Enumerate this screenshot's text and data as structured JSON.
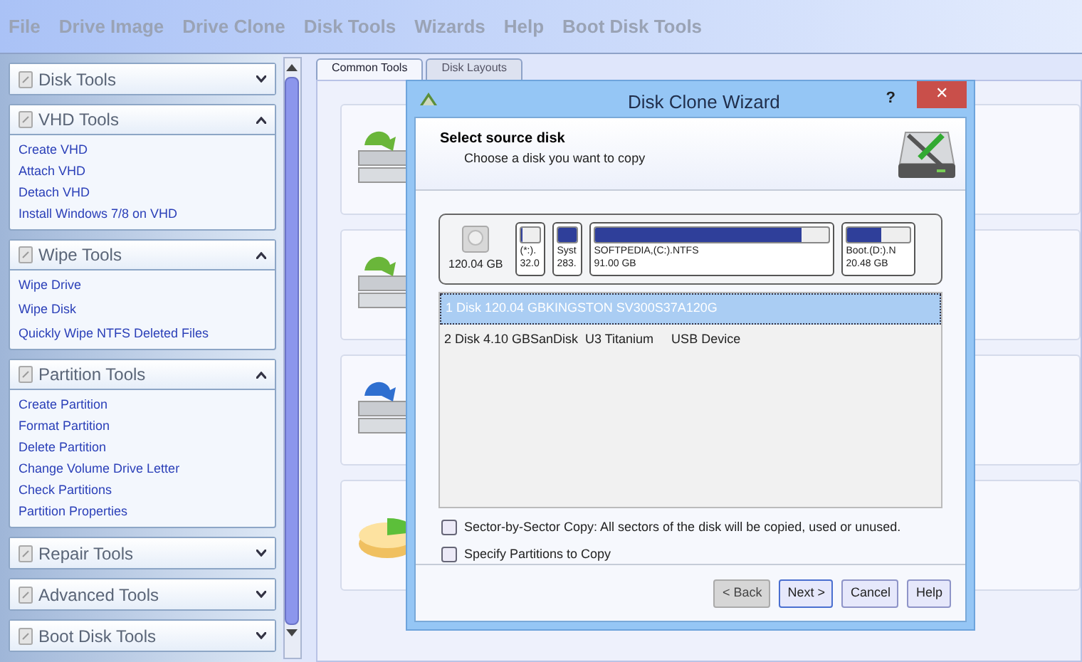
{
  "menu": [
    "File",
    "Drive Image",
    "Drive Clone",
    "Disk Tools",
    "Wizards",
    "Help",
    "Boot Disk Tools"
  ],
  "sidebar": [
    {
      "title": "Disk Tools",
      "expanded": false
    },
    {
      "title": "VHD Tools",
      "expanded": true,
      "items": [
        "Create VHD",
        "Attach VHD",
        "Detach VHD",
        "Install Windows 7/8 on VHD"
      ]
    },
    {
      "title": "Wipe Tools",
      "expanded": true,
      "items": [
        "Wipe Drive",
        "Wipe Disk",
        "Quickly Wipe NTFS Deleted Files"
      ]
    },
    {
      "title": "Partition Tools",
      "expanded": true,
      "items": [
        "Create Partition",
        "Format Partition",
        "Delete Partition",
        "Change Volume Drive Letter",
        "Check Partitions",
        "Partition Properties"
      ]
    },
    {
      "title": "Repair Tools",
      "expanded": false
    },
    {
      "title": "Advanced Tools",
      "expanded": false
    },
    {
      "title": "Boot Disk Tools",
      "expanded": false
    }
  ],
  "tabs": [
    {
      "label": "Common Tools",
      "selected": true
    },
    {
      "label": "Disk Layouts",
      "selected": false
    }
  ],
  "dialog": {
    "title": "Disk Clone Wizard",
    "help": "?",
    "close": "✕",
    "heading": "Select source disk",
    "subheading": "Choose a disk you want to copy",
    "disk_map": {
      "size": "120.04 GB",
      "partitions": [
        {
          "label": "(*:).",
          "size": "32.0",
          "level": 0.05
        },
        {
          "label": "Syst",
          "size": "283.",
          "level": 1
        },
        {
          "label": "SOFTPEDIA,(C:).NTFS",
          "size": "91.00 GB",
          "level": 0.88
        },
        {
          "label": "Boot.(D:).N",
          "size": "20.48 GB",
          "level": 0.55
        }
      ]
    },
    "disks": [
      {
        "text": "1 Disk 120.04 GBKINGSTON SV300S37A120G",
        "selected": true
      },
      {
        "text": "2 Disk 4.10 GBSanDisk  U3 Titanium     USB Device",
        "selected": false
      }
    ],
    "options": [
      {
        "label": "Sector-by-Sector Copy: All sectors of the disk will be copied, used or unused.",
        "checked": false
      },
      {
        "label": "Specify Partitions to Copy",
        "checked": false
      }
    ],
    "buttons": [
      {
        "label": "< Back",
        "disabled": true
      },
      {
        "label": "Next >",
        "disabled": false
      },
      {
        "label": "Cancel",
        "disabled": false
      },
      {
        "label": "Help",
        "disabled": false
      }
    ]
  }
}
